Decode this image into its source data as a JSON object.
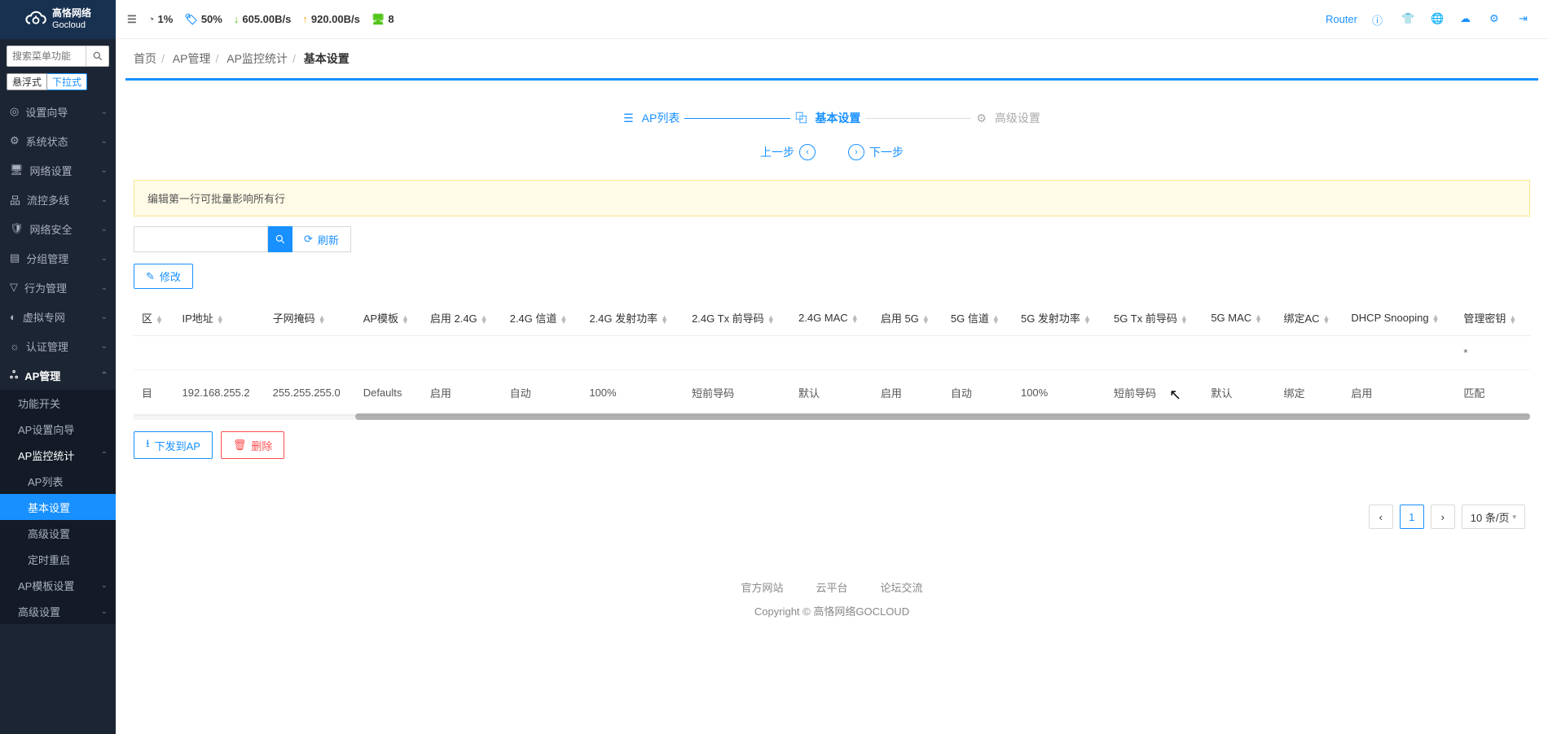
{
  "brand": {
    "name_cn": "高恪网络",
    "name_en": "Gocloud"
  },
  "header_stats": {
    "cpu": "1%",
    "disk": "50%",
    "down": "605.00B/s",
    "up": "920.00B/s",
    "devices": "8",
    "router_label": "Router"
  },
  "sidebar": {
    "search_placeholder": "搜索菜单功能",
    "mode_float": "悬浮式",
    "mode_drop": "下拉式",
    "items": [
      {
        "label": "设置向导"
      },
      {
        "label": "系统状态"
      },
      {
        "label": "网络设置"
      },
      {
        "label": "流控多线"
      },
      {
        "label": "网络安全"
      },
      {
        "label": "分组管理"
      },
      {
        "label": "行为管理"
      },
      {
        "label": "虚拟专网"
      },
      {
        "label": "认证管理"
      }
    ],
    "ap_mgmt": {
      "label": "AP管理",
      "children": [
        {
          "label": "功能开关"
        },
        {
          "label": "AP设置向导"
        },
        {
          "label": "AP监控统计",
          "children": [
            {
              "label": "AP列表"
            },
            {
              "label": "基本设置"
            },
            {
              "label": "高级设置"
            },
            {
              "label": "定时重启"
            }
          ]
        },
        {
          "label": "AP模板设置"
        },
        {
          "label": "高级设置"
        }
      ]
    }
  },
  "breadcrumb": [
    "首页",
    "AP管理",
    "AP监控统计",
    "基本设置"
  ],
  "steps": {
    "s1": "AP列表",
    "s2": "基本设置",
    "s3": "高级设置",
    "prev": "上一步",
    "next": "下一步"
  },
  "alert": "编辑第一行可批量影响所有行",
  "toolbar": {
    "refresh": "刷新",
    "edit": "修改"
  },
  "table": {
    "headers": [
      "区",
      "IP地址",
      "子网掩码",
      "AP模板",
      "启用 2.4G",
      "2.4G 信道",
      "2.4G 发射功率",
      "2.4G Tx 前导码",
      "2.4G MAC",
      "启用 5G",
      "5G 信道",
      "5G 发射功率",
      "5G Tx 前导码",
      "5G MAC",
      "绑定AC",
      "DHCP Snooping",
      "管理密钥"
    ],
    "row0_star": "*",
    "row": {
      "zone": "目",
      "ip": "192.168.255.2",
      "mask": "255.255.255.0",
      "tpl": "Defaults",
      "en24": "启用",
      "ch24": "自动",
      "pw24": "100%",
      "tx24": "短前导码",
      "mac24": "默认",
      "en5": "启用",
      "ch5": "自动",
      "pw5": "100%",
      "tx5": "短前导码",
      "mac5": "默认",
      "bind": "绑定",
      "dhcp": "启用",
      "key": "匹配"
    }
  },
  "actions": {
    "deploy": "下发到AP",
    "delete": "删除"
  },
  "pager": {
    "page": "1",
    "size": "10 条/页"
  },
  "footer": {
    "links": [
      "官方网站",
      "云平台",
      "论坛交流"
    ],
    "copy": "Copyright © 高恪网络GOCLOUD"
  }
}
